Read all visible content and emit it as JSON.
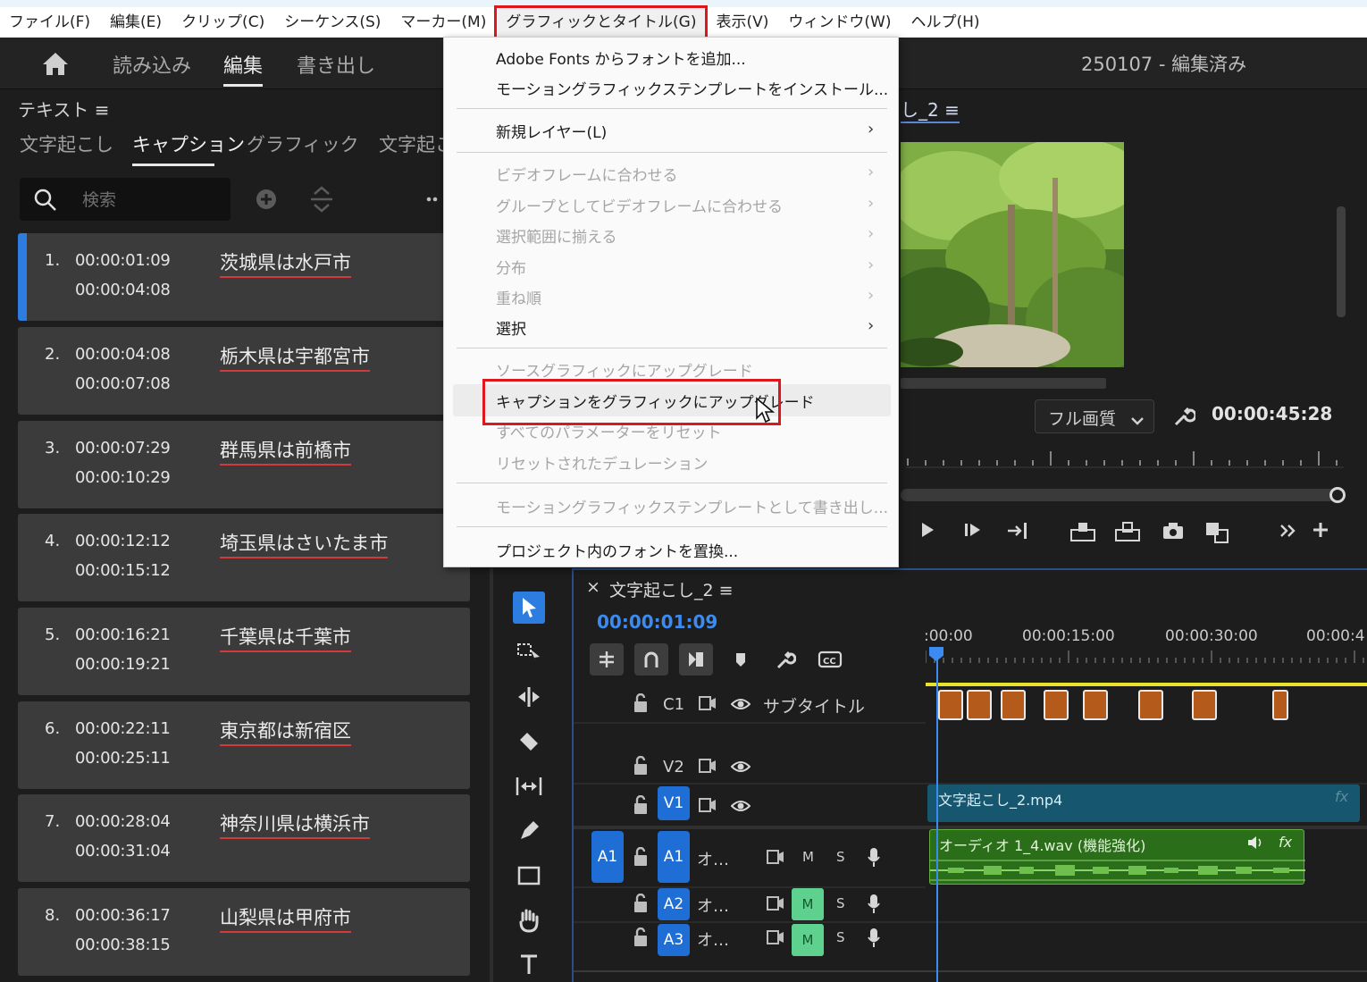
{
  "menubar": {
    "items": [
      "ファイル(F)",
      "編集(E)",
      "クリップ(C)",
      "シーケンス(S)",
      "マーカー(M)",
      "グラフィックとタイトル(G)",
      "表示(V)",
      "ウィンドウ(W)",
      "ヘルプ(H)"
    ],
    "active_index": 5
  },
  "workspace": {
    "tabs": [
      "読み込み",
      "編集",
      "書き出し"
    ],
    "active": "編集",
    "project_title": "250107 - 編集済み"
  },
  "text_panel": {
    "title": "テキスト ≡",
    "tabs": [
      "文字起こし",
      "キャプション",
      "グラフィック",
      "文字起こ"
    ],
    "active_tab": "キャプション",
    "search_placeholder": "検索",
    "captions": [
      {
        "num": "1.",
        "in": "00:00:01:09",
        "out": "00:00:04:08",
        "text": "茨城県は水戸市",
        "selected": true
      },
      {
        "num": "2.",
        "in": "00:00:04:08",
        "out": "00:00:07:08",
        "text": "栃木県は宇都宮市"
      },
      {
        "num": "3.",
        "in": "00:00:07:29",
        "out": "00:00:10:29",
        "text": "群馬県は前橋市"
      },
      {
        "num": "4.",
        "in": "00:00:12:12",
        "out": "00:00:15:12",
        "text": "埼玉県はさいたま市"
      },
      {
        "num": "5.",
        "in": "00:00:16:21",
        "out": "00:00:19:21",
        "text": "千葉県は千葉市"
      },
      {
        "num": "6.",
        "in": "00:00:22:11",
        "out": "00:00:25:11",
        "text": "東京都は新宿区"
      },
      {
        "num": "7.",
        "in": "00:00:28:04",
        "out": "00:00:31:04",
        "text": "神奈川県は横浜市"
      },
      {
        "num": "8.",
        "in": "00:00:36:17",
        "out": "00:00:38:15",
        "text": "山梨県は甲府市"
      }
    ]
  },
  "dropdown": {
    "items": [
      {
        "label": "Adobe Fonts からフォントを追加...",
        "enabled": true,
        "submenu": false
      },
      {
        "label": "モーショングラフィックステンプレートをインストール...",
        "enabled": true,
        "submenu": false
      },
      {
        "label": "新規レイヤー(L)",
        "enabled": true,
        "submenu": true
      },
      {
        "label": "ビデオフレームに合わせる",
        "enabled": false,
        "submenu": true
      },
      {
        "label": "グループとしてビデオフレームに合わせる",
        "enabled": false,
        "submenu": true
      },
      {
        "label": "選択範囲に揃える",
        "enabled": false,
        "submenu": true
      },
      {
        "label": "分布",
        "enabled": false,
        "submenu": true
      },
      {
        "label": "重ね順",
        "enabled": false,
        "submenu": true
      },
      {
        "label": "選択",
        "enabled": true,
        "submenu": true
      },
      {
        "label": "ソースグラフィックにアップグレード",
        "enabled": false,
        "submenu": false
      },
      {
        "label": "キャプションをグラフィックにアップグレード",
        "enabled": true,
        "submenu": false,
        "highlighted": true
      },
      {
        "label": "すべてのパラメーターをリセット",
        "enabled": false,
        "submenu": false
      },
      {
        "label": "リセットされたデュレーション",
        "enabled": false,
        "submenu": false
      },
      {
        "label": "モーショングラフィックステンプレートとして書き出し...",
        "enabled": false,
        "submenu": false
      },
      {
        "label": "プロジェクト内のフォントを置換...",
        "enabled": true,
        "submenu": false
      }
    ]
  },
  "monitor": {
    "title": "し_2 ≡",
    "quality": "フル画質",
    "timecode": "00:00:45:28"
  },
  "timeline": {
    "title": "文字起こし_2 ≡",
    "close": "×",
    "timecode": "00:00:01:09",
    "ruler_labels": [
      ":00:00",
      "00:00:15:00",
      "00:00:30:00",
      "00:00:4"
    ],
    "tracks": {
      "c1": {
        "name": "C1",
        "label": "サブタイトル"
      },
      "v2": {
        "name": "V2"
      },
      "v1": {
        "name": "V1"
      },
      "a1": {
        "name": "A1",
        "src": "A1",
        "label": "オ…",
        "m": "M",
        "s": "S"
      },
      "a2": {
        "name": "A2",
        "label": "オ…",
        "m": "M",
        "s": "S"
      },
      "a3": {
        "name": "A3",
        "label": "オ…",
        "m": "M",
        "s": "S"
      }
    },
    "video_clip": "文字起こし_2.mp4",
    "audio_clip": "オーディオ 1_4.wav (機能強化)",
    "fx": "fx"
  },
  "colors": {
    "accent_blue": "#2d7de0",
    "highlight_red": "#e0161d",
    "caption_clip": "#b45a1b",
    "video_clip": "#16566f",
    "audio_clip": "#2b6e1a",
    "mute_green": "#5fd18e"
  }
}
